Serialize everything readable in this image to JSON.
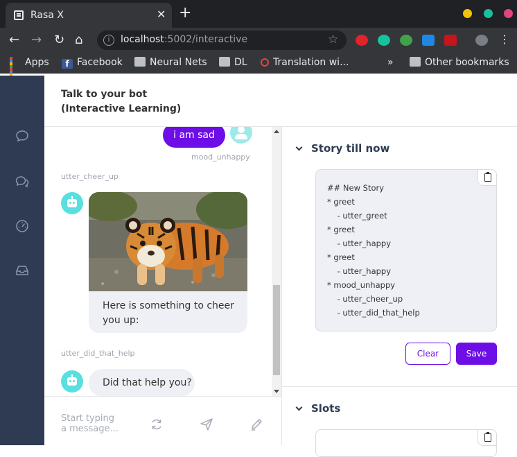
{
  "browser": {
    "tab_title": "Rasa X",
    "tab_close": "✕",
    "new_tab": "+",
    "url_host": "localhost",
    "url_path": ":5002/interactive",
    "bookmarks": [
      {
        "label": "Apps"
      },
      {
        "label": "Facebook"
      },
      {
        "label": "Neural Nets"
      },
      {
        "label": "DL"
      },
      {
        "label": "Translation wi..."
      },
      {
        "label": "»"
      },
      {
        "label": "Other bookmarks"
      }
    ],
    "window_dot_colors": [
      "#f4c20d",
      "#1bbf9f",
      "#e2457c"
    ]
  },
  "header": {
    "line1": "Talk to your bot",
    "line2": "(Interactive Learning)"
  },
  "chat": {
    "user_message": "i am sad",
    "intent_label": "mood_unhappy",
    "action1": "utter_cheer_up",
    "card_text": "Here is something to cheer you up:",
    "action2": "utter_did_that_help",
    "bot_message": "Did that help you?",
    "composer_placeholder_1": "Start typing",
    "composer_placeholder_2": "a message..."
  },
  "story_panel": {
    "title": "Story till now",
    "story_text": "## New Story\n* greet\n    - utter_greet\n* greet\n    - utter_happy\n* greet\n    - utter_happy\n* mood_unhappy\n    - utter_cheer_up\n    - utter_did_that_help",
    "clear_label": "Clear",
    "save_label": "Save"
  },
  "slots_panel": {
    "title": "Slots"
  },
  "colors": {
    "accent": "#6d0ee6",
    "sidebar": "#2e3b52",
    "bot_avatar": "#59dfe0"
  }
}
